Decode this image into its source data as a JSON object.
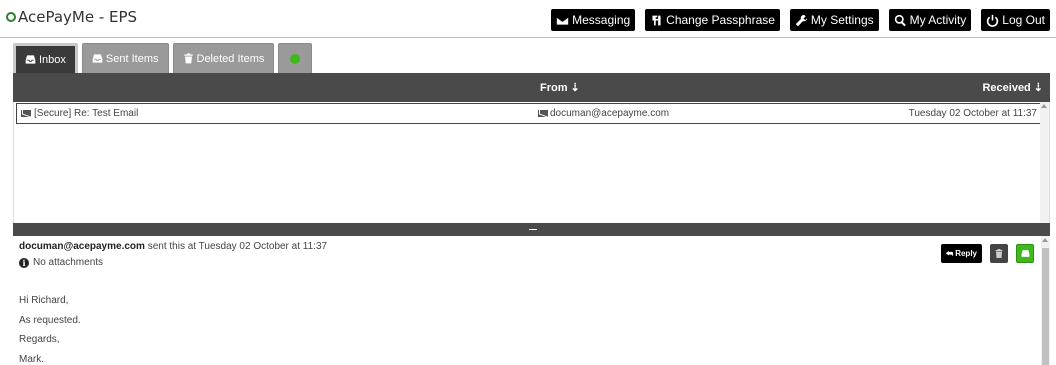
{
  "app": {
    "title": "AcePayMe - EPS"
  },
  "nav": {
    "messaging": "Messaging",
    "change_passphrase": "Change Passphrase",
    "my_settings": "My Settings",
    "my_activity": "My Activity",
    "log_out": "Log Out"
  },
  "tabs": [
    {
      "label": "Inbox",
      "active": true
    },
    {
      "label": "Sent Items",
      "active": false
    },
    {
      "label": "Deleted Items",
      "active": false
    }
  ],
  "list": {
    "columns": {
      "from": "From",
      "received": "Received"
    },
    "rows": [
      {
        "subject": "[Secure] Re: Test Email",
        "from": "documan@acepayme.com",
        "received": "Tuesday 02 October at 11:37"
      }
    ]
  },
  "preview": {
    "sender": "documan@acepayme.com",
    "sent_text": " sent this at Tuesday 02 October at 11:37",
    "attachments": "No attachments",
    "reply_label": "Reply",
    "body": [
      "Hi Richard,",
      "As requested.",
      "Regards,",
      "Mark."
    ]
  },
  "colors": {
    "brand_green": "#3fb81b",
    "header_bar": "#4a4a4a",
    "nav_button": "#000000"
  }
}
